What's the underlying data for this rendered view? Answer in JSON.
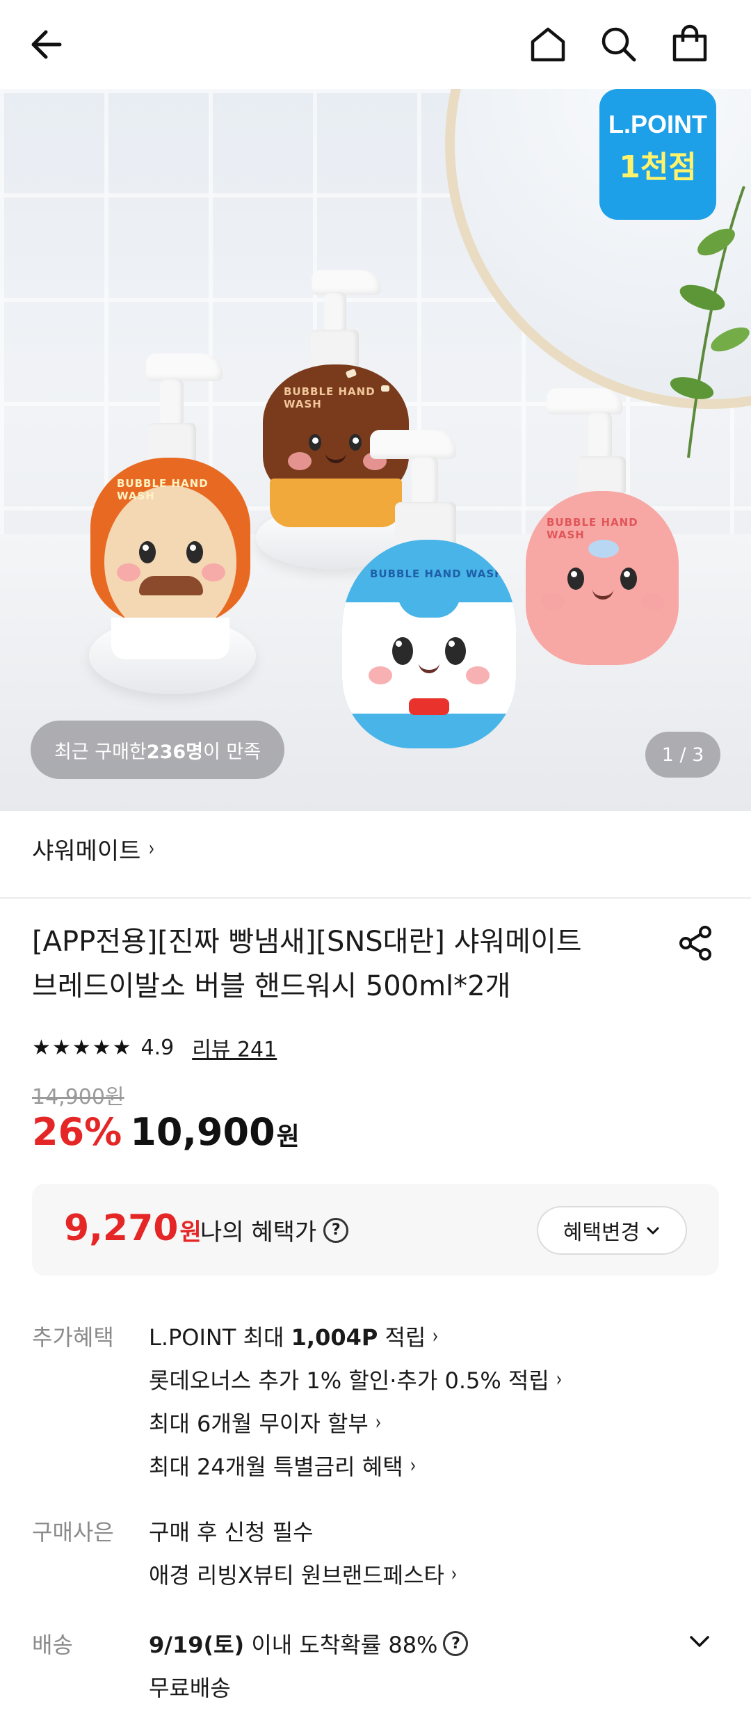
{
  "header": {
    "back_icon": "arrow-left-icon",
    "home_icon": "home-icon",
    "search_icon": "search-icon",
    "cart_icon": "shopping-bag-icon"
  },
  "hero": {
    "badge_line1": "L.POINT",
    "badge_line2": "1천점",
    "buyers_prefix": "최근 구매한 ",
    "buyers_count": "236명",
    "buyers_suffix": "이 만족",
    "page_indicator": "1 / 3",
    "bottle_label": "BUBBLE HAND WASH"
  },
  "brand": {
    "name": "샤워메이트",
    "chevron": "›"
  },
  "product": {
    "title_line1": "[APP전용][진짜 빵냄새][SNS대란] 샤워메이트",
    "title_line2": "브레드이발소 버블 핸드워시 500ml*2개",
    "share_icon": "share-icon"
  },
  "rating": {
    "stars": "★★★★★",
    "value": "4.9",
    "reviews": "리뷰 241"
  },
  "pricing": {
    "original": "14,900원",
    "discount": "26%",
    "price": "10,900",
    "currency": "원"
  },
  "benefit": {
    "price": "9,270",
    "currency": "원",
    "label": "나의 혜택가",
    "help": "?",
    "change_button": "혜택변경"
  },
  "extra_benefits": {
    "label": "추가혜택",
    "items": [
      {
        "prefix": "L.POINT 최대 ",
        "bold": "1,004P",
        "suffix": " 적립"
      },
      {
        "prefix": "롯데오너스 추가 1% 할인·추가 0.5% 적립",
        "bold": "",
        "suffix": ""
      },
      {
        "prefix": "최대 6개월 무이자 할부",
        "bold": "",
        "suffix": ""
      },
      {
        "prefix": "최대 24개월 특별금리 혜택",
        "bold": "",
        "suffix": ""
      }
    ]
  },
  "gift": {
    "label": "구매사은",
    "line1": "구매 후 신청 필수",
    "line2": "애경 리빙X뷰티 원브랜드페스타"
  },
  "delivery": {
    "label": "배송",
    "date": "9/19(토)",
    "rest": " 이내 도착확률 88%",
    "help": "?",
    "free": "무료배송"
  },
  "colors": {
    "accent_red": "#e52626",
    "lpoint_blue": "#1da0e8"
  }
}
